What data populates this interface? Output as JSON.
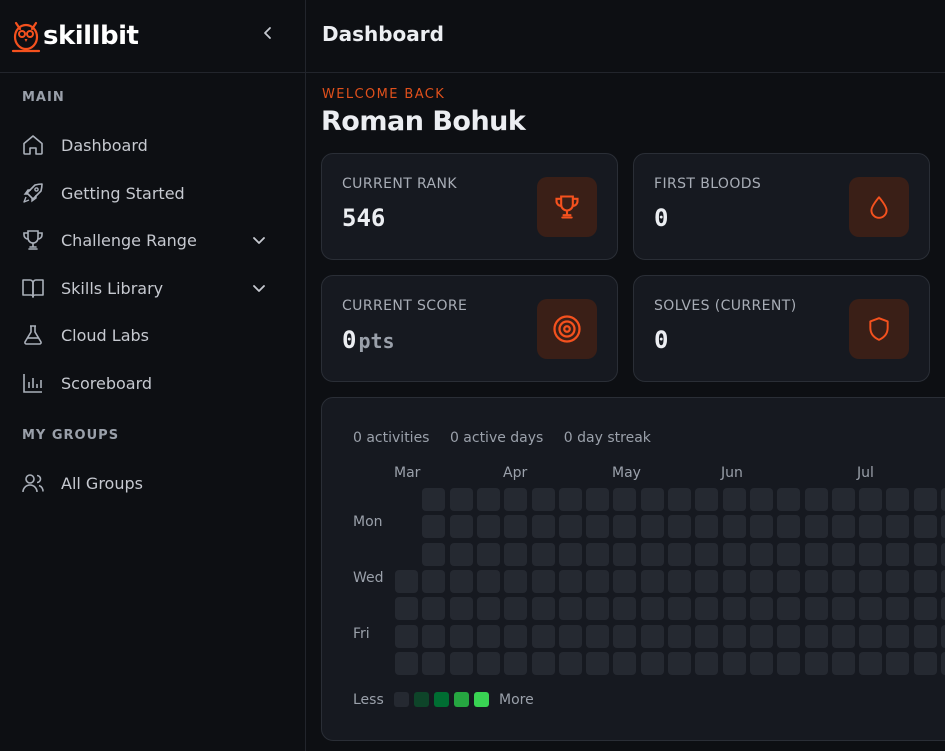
{
  "brand": {
    "name": "skillbit",
    "accent": "#f4511e"
  },
  "sidebar": {
    "sections": [
      {
        "title": "MAIN"
      },
      {
        "title": "MY GROUPS"
      }
    ],
    "items": [
      {
        "label": "Dashboard",
        "icon": "home-icon"
      },
      {
        "label": "Getting Started",
        "icon": "rocket-icon"
      },
      {
        "label": "Challenge Range",
        "icon": "trophy-icon",
        "expandable": true
      },
      {
        "label": "Skills Library",
        "icon": "book-icon",
        "expandable": true
      },
      {
        "label": "Cloud Labs",
        "icon": "flask-icon"
      },
      {
        "label": "Scoreboard",
        "icon": "bar-chart-icon"
      },
      {
        "label": "All Groups",
        "icon": "users-icon"
      }
    ]
  },
  "header": {
    "title": "Dashboard"
  },
  "welcome": {
    "kicker": "WELCOME BACK",
    "name": "Roman Bohuk"
  },
  "stats_cards": [
    {
      "label": "CURRENT RANK",
      "value": "546",
      "icon": "trophy-icon"
    },
    {
      "label": "FIRST BLOODS",
      "value": "0",
      "icon": "drop-icon"
    },
    {
      "label": "CURRENT SCORE",
      "value": "0",
      "unit": "pts",
      "icon": "target-icon"
    },
    {
      "label": "SOLVES (CURRENT)",
      "value": "0",
      "icon": "shield-icon"
    }
  ],
  "activity": {
    "activities": "0 activities",
    "active_days": "0 active days",
    "streak": "0 day streak",
    "months": [
      "Mar",
      "Apr",
      "May",
      "Jun",
      "Jul"
    ],
    "days": [
      "Mon",
      "Wed",
      "Fri"
    ],
    "legend_less": "Less",
    "legend_more": "More",
    "legend_colors": [
      "#252931",
      "#0e4429",
      "#006d32",
      "#26a641",
      "#39d353"
    ],
    "empty_cell_color": "#252931"
  }
}
